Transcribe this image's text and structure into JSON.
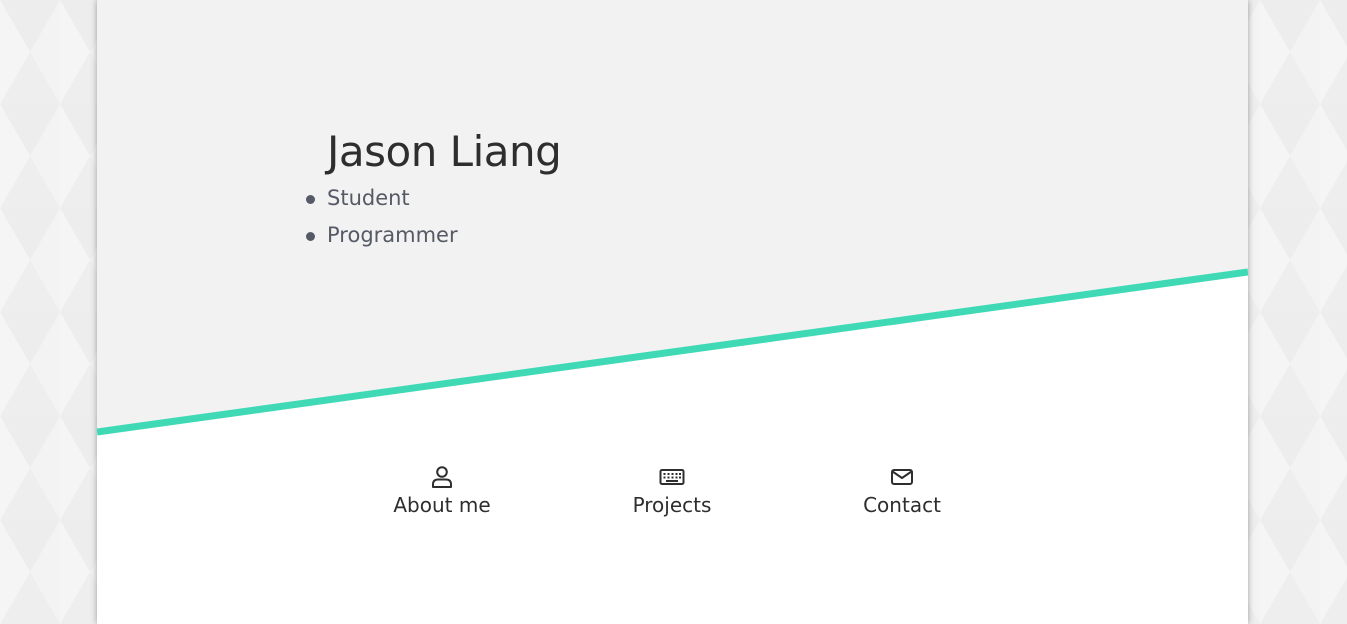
{
  "hero": {
    "name": "Jason Liang",
    "roles": [
      "Student",
      "Programmer"
    ]
  },
  "nav": [
    {
      "label": "About me",
      "icon": "user-icon"
    },
    {
      "label": "Projects",
      "icon": "keyboard-icon"
    },
    {
      "label": "Contact",
      "icon": "envelope-icon"
    }
  ],
  "colors": {
    "accent": "#40d9b6",
    "hero_background": "#f2f2f2",
    "card_background": "#ffffff",
    "text_dark": "#2e2e2e",
    "text_muted": "#555a66"
  }
}
